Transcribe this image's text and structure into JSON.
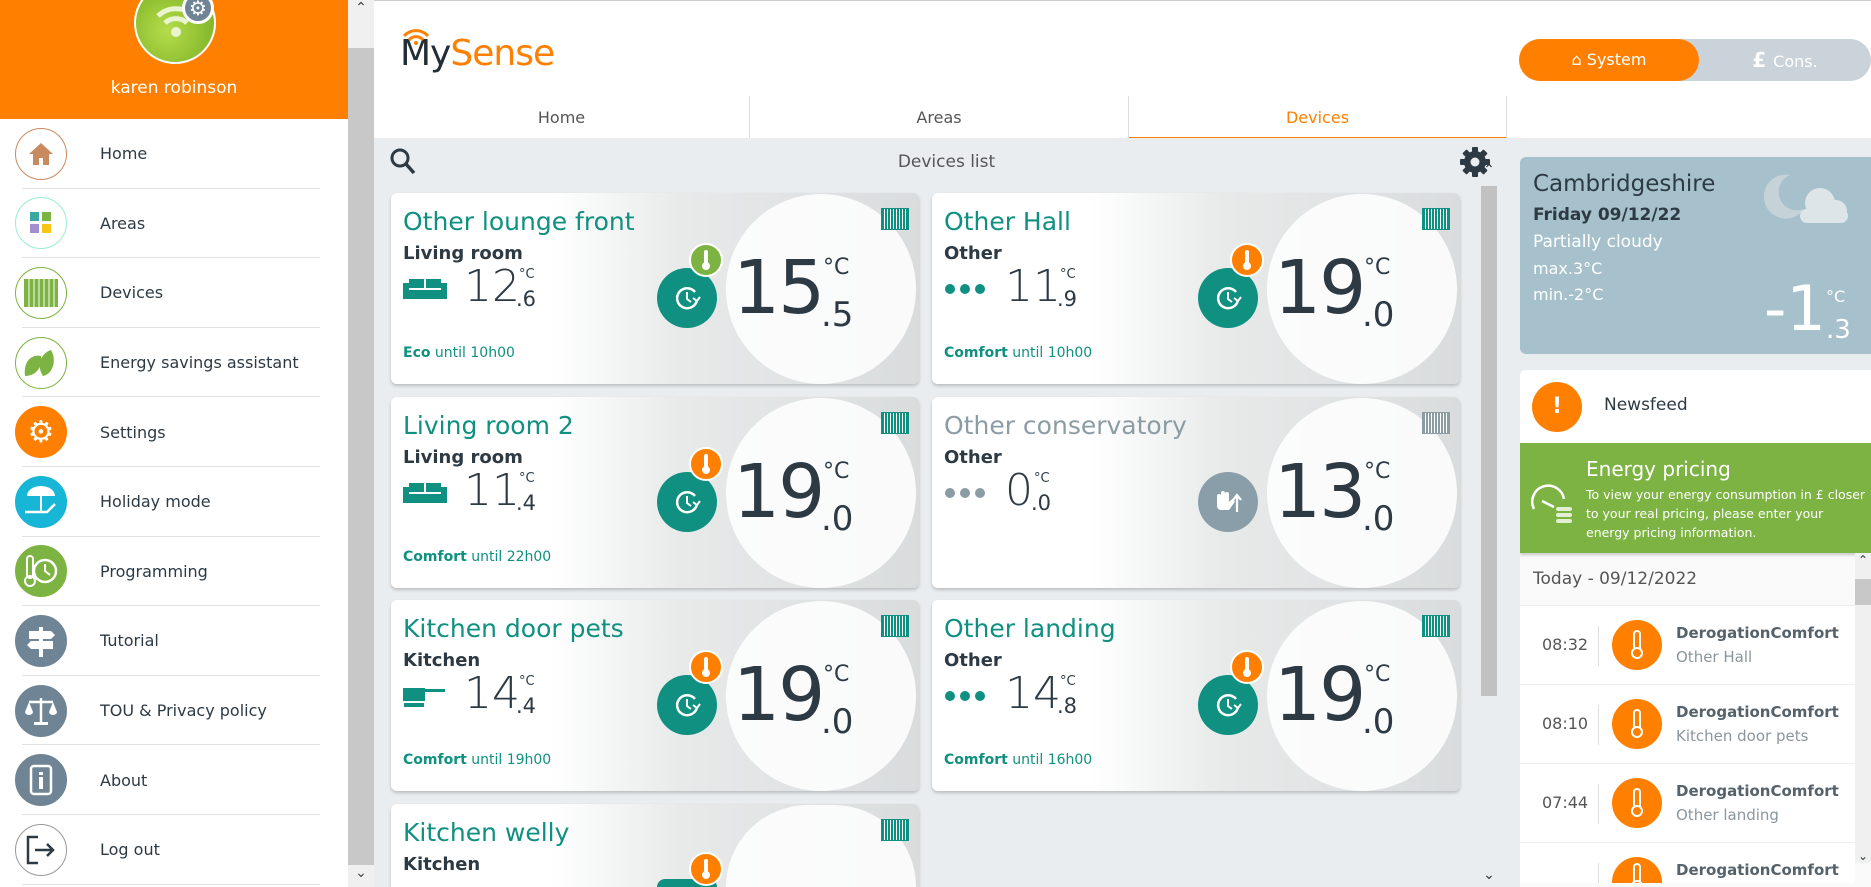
{
  "user": {
    "name": "karen robinson"
  },
  "sidebar": {
    "items": [
      {
        "label": "Home",
        "icon": "home-icon",
        "color": "#c98a5f"
      },
      {
        "label": "Areas",
        "icon": "areas-grid-icon",
        "color": "#9ec"
      },
      {
        "label": "Devices",
        "icon": "radiator-icon",
        "color": "#7cb342"
      },
      {
        "label": "Energy savings assistant",
        "icon": "leaves-icon",
        "color": "#7cb342"
      },
      {
        "label": "Settings",
        "icon": "gear-icon",
        "color": "#ff8000"
      },
      {
        "label": "Holiday mode",
        "icon": "beach-chair-icon",
        "color": "#17b5d6"
      },
      {
        "label": "Programming",
        "icon": "thermo-clock-icon",
        "color": "#7cb342"
      },
      {
        "label": "Tutorial",
        "icon": "signpost-icon",
        "color": "#6f8494"
      },
      {
        "label": "TOU & Privacy policy",
        "icon": "scales-icon",
        "color": "#6f8494"
      },
      {
        "label": "About",
        "icon": "info-icon",
        "color": "#6f8494"
      },
      {
        "label": "Log out",
        "icon": "logout-icon",
        "color": "#fff"
      }
    ]
  },
  "header": {
    "logo_my": "My",
    "logo_sense": "Sense",
    "tabs": [
      "Home",
      "Areas",
      "Devices"
    ],
    "active_tab": "Devices",
    "toggle": {
      "system": "System",
      "cons": "Cons."
    }
  },
  "devices": {
    "title": "Devices list",
    "cards": [
      {
        "name": "Other lounge front",
        "room": "Living room",
        "room_icon": "sofa",
        "current_int": "12",
        "current_dec": ".6",
        "set_int": "15",
        "set_dec": ".5",
        "unit": "°C",
        "mode_bold": "Eco",
        "mode_rest": " until 10h00",
        "badge": "green",
        "state": "on"
      },
      {
        "name": "Other Hall",
        "room": "Other",
        "room_icon": "dots",
        "current_int": "11",
        "current_dec": ".9",
        "set_int": "19",
        "set_dec": ".0",
        "unit": "°C",
        "mode_bold": "Comfort",
        "mode_rest": " until 10h00",
        "badge": "orange",
        "state": "on"
      },
      {
        "name": "Living room 2",
        "room": "Living room",
        "room_icon": "sofa",
        "current_int": "11",
        "current_dec": ".4",
        "set_int": "19",
        "set_dec": ".0",
        "unit": "°C",
        "mode_bold": "Comfort",
        "mode_rest": " until 22h00",
        "badge": "orange",
        "state": "on"
      },
      {
        "name": "Other conservatory",
        "room": "Other",
        "room_icon": "dots",
        "current_int": "0",
        "current_dec": ".0",
        "set_int": "13",
        "set_dec": ".0",
        "unit": "°C",
        "mode_bold": "",
        "mode_rest": "",
        "badge": "none",
        "state": "off"
      },
      {
        "name": "Kitchen door pets",
        "room": "Kitchen",
        "room_icon": "pan",
        "current_int": "14",
        "current_dec": ".4",
        "set_int": "19",
        "set_dec": ".0",
        "unit": "°C",
        "mode_bold": "Comfort",
        "mode_rest": " until 19h00",
        "badge": "orange",
        "state": "on"
      },
      {
        "name": "Other landing",
        "room": "Other",
        "room_icon": "dots",
        "current_int": "14",
        "current_dec": ".8",
        "set_int": "19",
        "set_dec": ".0",
        "unit": "°C",
        "mode_bold": "Comfort",
        "mode_rest": " until 16h00",
        "badge": "orange",
        "state": "on"
      },
      {
        "name": "Kitchen welly",
        "room": "Kitchen",
        "room_icon": "pan",
        "badge": "orange",
        "state": "on"
      }
    ]
  },
  "weather": {
    "location": "Cambridgeshire",
    "date": "Friday 09/12/22",
    "description": "Partially cloudy",
    "max": "max.3°C",
    "min": "min.-2°C",
    "temp_int": "-1",
    "temp_dec": ".3",
    "unit": "°C"
  },
  "newsfeed": {
    "title": "Newsfeed",
    "pricing": {
      "title": "Energy pricing",
      "body": "To view your energy consumption in £ closer to your real pricing, please enter your energy pricing information."
    },
    "date_label": "Today -  09/12/2022",
    "items": [
      {
        "time": "08:32",
        "event": "DerogationComfort",
        "device": "Other Hall"
      },
      {
        "time": "08:10",
        "event": "DerogationComfort",
        "device": "Kitchen door pets"
      },
      {
        "time": "07:44",
        "event": "DerogationComfort",
        "device": "Other landing"
      },
      {
        "time": "",
        "event": "DerogationComfort",
        "device": ""
      }
    ]
  },
  "colors": {
    "brand": "#ff8000",
    "teal": "#0f9080",
    "green": "#7cb342",
    "weather": "#a6c1cb"
  }
}
